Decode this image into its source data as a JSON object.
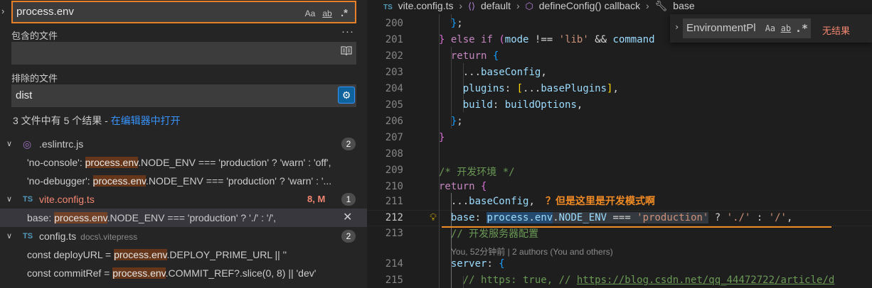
{
  "search": {
    "query": "process.env",
    "case_label": "Aa",
    "word_label": "ab",
    "regex_label": ".*",
    "more_label": "···",
    "include_label": "包含的文件",
    "include_value": "",
    "exclude_label": "排除的文件",
    "exclude_value": "dist",
    "summary_text": "3 文件中有 5 个结果 - ",
    "summary_link": "在编辑器中打开"
  },
  "results": {
    "files": [
      {
        "name": ".eslintrc.js",
        "path": "",
        "count": "2",
        "matches": [
          {
            "pre": "'no-console': ",
            "hit": "process.env",
            "post": ".NODE_ENV === 'production' ? 'warn' : 'off',"
          },
          {
            "pre": "'no-debugger': ",
            "hit": "process.env",
            "post": ".NODE_ENV === 'production' ? 'warn' : '..."
          }
        ]
      },
      {
        "name": "vite.config.ts",
        "path": "",
        "status": "8, M",
        "count": "1",
        "matches": [
          {
            "pre": "base: ",
            "hit": "process.env",
            "post": ".NODE_ENV === 'production' ? './' : '/',"
          }
        ]
      },
      {
        "name": "config.ts",
        "path": "docs\\.vitepress",
        "count": "2",
        "matches": [
          {
            "pre": "const deployURL = ",
            "hit": "process.env",
            "post": ".DEPLOY_PRIME_URL || ''"
          },
          {
            "pre": "const commitRef = ",
            "hit": "process.env",
            "post": ".COMMIT_REF?.slice(0, 8) || 'dev'"
          }
        ]
      }
    ],
    "close_glyph": "✕"
  },
  "breadcrumb": {
    "ts_tag": "TS",
    "file": "vite.config.ts",
    "item1": "default",
    "item2": "defineConfig() callback",
    "item3": "base"
  },
  "editor": {
    "line_numbers": [
      "200",
      "201",
      "202",
      "203",
      "204",
      "205",
      "206",
      "207",
      "208",
      "209",
      "210",
      "211",
      "212",
      "213",
      "214",
      "215"
    ],
    "annotation": "？但是这里是开发模式啊",
    "blame": "You, 52分钟前 | 2 authors (You and others)"
  },
  "find_widget": {
    "query": "EnvironmentPl",
    "case_label": "Aa",
    "word_label": "ab",
    "regex_label": ".*",
    "result": "无结果"
  },
  "colors": {
    "accent_orange": "#f08a24",
    "link_blue": "#3794ff",
    "error_red": "#f48771",
    "modified_yellow": "#e2c08d"
  }
}
